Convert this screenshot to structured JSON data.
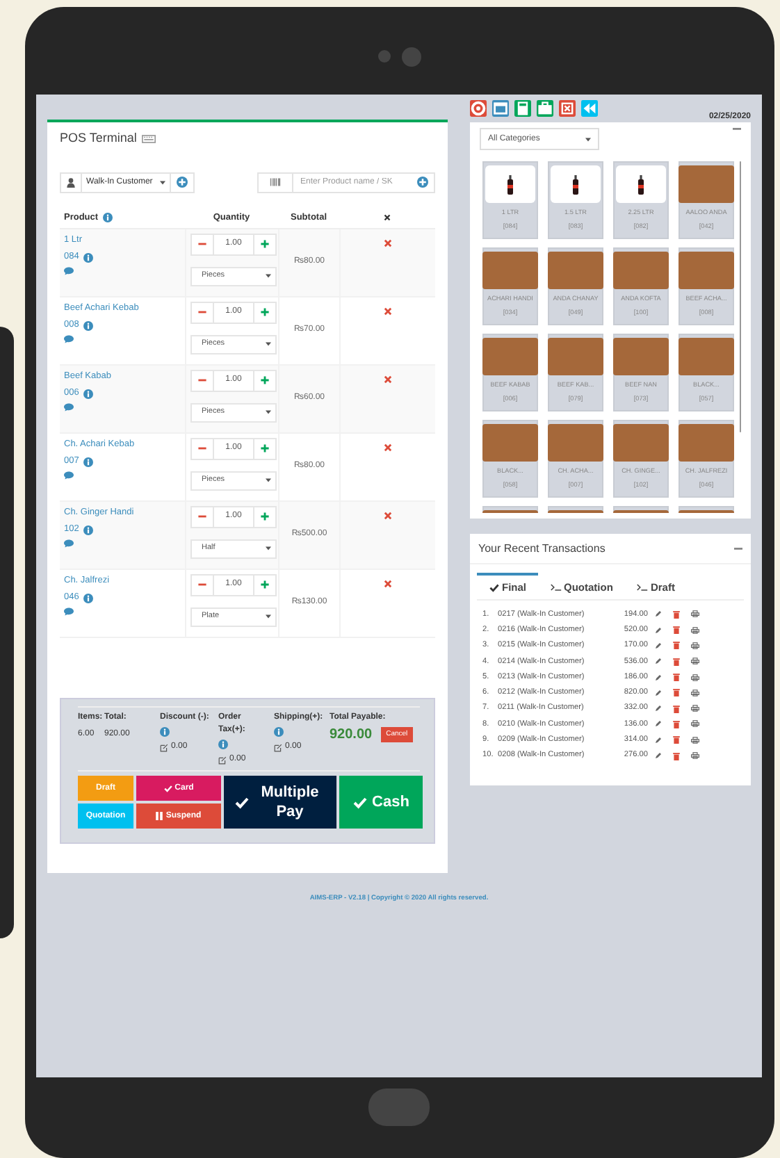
{
  "toolbar": {
    "icons": [
      {
        "kind": "lifebuoy",
        "color": "#dd4b39"
      },
      {
        "kind": "window",
        "color": "#3c8dbc"
      },
      {
        "kind": "calculator",
        "color": "#00a65a"
      },
      {
        "kind": "briefcase",
        "color": "#00a65a"
      },
      {
        "kind": "close",
        "color": "#dd4b39"
      },
      {
        "kind": "rewind",
        "color": "#00c0ef"
      }
    ],
    "date": "02/25/2020"
  },
  "pos_panel": {
    "title": "POS Terminal",
    "customer": "Walk-In Customer",
    "product_search_placeholder": "Enter Product name / SK",
    "columns": [
      "Product",
      "Quantity",
      "Subtotal"
    ],
    "cart": [
      {
        "name": "1 Ltr",
        "code": "084",
        "quantity": "1.00",
        "unit": "Pieces",
        "subtotal": "₨80.00"
      },
      {
        "name": "Beef Achari Kebab",
        "code": "008",
        "quantity": "1.00",
        "unit": "Pieces",
        "subtotal": "₨70.00"
      },
      {
        "name": "Beef Kabab",
        "code": "006",
        "quantity": "1.00",
        "unit": "Pieces",
        "subtotal": "₨60.00"
      },
      {
        "name": "Ch. Achari Kebab",
        "code": "007",
        "quantity": "1.00",
        "unit": "Pieces",
        "subtotal": "₨80.00"
      },
      {
        "name": "Ch. Ginger Handi",
        "code": "102",
        "quantity": "1.00",
        "unit": "Half",
        "subtotal": "₨500.00"
      },
      {
        "name": "Ch. Jalfrezi",
        "code": "046",
        "quantity": "1.00",
        "unit": "Plate",
        "subtotal": "₨130.00"
      }
    ],
    "summary": [
      {
        "label": "Items:",
        "value": "6.00",
        "kind": "plain"
      },
      {
        "label": "Total:",
        "value": "920.00",
        "kind": "plain"
      },
      {
        "label": "Discount (-):",
        "value": "0.00",
        "kind": "adjustment"
      },
      {
        "label": "Order Tax(+):",
        "value": "0.00",
        "kind": "adjustment"
      },
      {
        "label": "Shipping(+):",
        "value": "0.00",
        "kind": "adjustment"
      }
    ],
    "payable": {
      "label": "Total Payable:",
      "value": "920.00",
      "cancel": "Cancel"
    },
    "buttons": [
      {
        "label": "Draft",
        "kind": "draft"
      },
      {
        "label": "Card",
        "kind": "card"
      },
      {
        "label": "Multiple Pay",
        "kind": "multiple"
      },
      {
        "label": "Cash",
        "kind": "cash"
      },
      {
        "label": "Quotation",
        "kind": "quotation"
      },
      {
        "label": "Suspend",
        "kind": "suspend"
      }
    ]
  },
  "categories": {
    "filter": "All Categories",
    "products": [
      {
        "name": "1 LTR",
        "code": "[084]",
        "kind": "bottle"
      },
      {
        "name": "1.5 LTR",
        "code": "[083]",
        "kind": "bottle"
      },
      {
        "name": "2.25 LTR",
        "code": "[082]",
        "kind": "bottle"
      },
      {
        "name": "AALOO ANDA",
        "code": "[042]",
        "kind": "photo"
      },
      {
        "name": "ACHARI HANDI",
        "code": "[034]",
        "kind": "photo"
      },
      {
        "name": "ANDA CHANAY",
        "code": "[049]",
        "kind": "photo"
      },
      {
        "name": "ANDA KOFTA",
        "code": "[100]",
        "kind": "photo"
      },
      {
        "name": "BEEF ACHA...",
        "code": "[008]",
        "kind": "photo"
      },
      {
        "name": "BEEF KABAB",
        "code": "[006]",
        "kind": "photo"
      },
      {
        "name": "BEEF KAB...",
        "code": "[079]",
        "kind": "photo"
      },
      {
        "name": "BEEF NAN",
        "code": "[073]",
        "kind": "photo"
      },
      {
        "name": "BLACK...",
        "code": "[057]",
        "kind": "photo"
      },
      {
        "name": "BLACK...",
        "code": "[058]",
        "kind": "photo"
      },
      {
        "name": "CH. ACHA...",
        "code": "[007]",
        "kind": "photo"
      },
      {
        "name": "CH. GINGE...",
        "code": "[102]",
        "kind": "photo"
      },
      {
        "name": "CH. JALFREZI",
        "code": "[046]",
        "kind": "photo"
      },
      {
        "kind": "photo"
      },
      {
        "kind": "photo"
      },
      {
        "kind": "photo"
      },
      {
        "kind": "photo"
      }
    ]
  },
  "transactions": {
    "title": "Your Recent Transactions",
    "tabs": [
      {
        "label": "Final",
        "kind": "check",
        "selected": true
      },
      {
        "label": "Quotation",
        "kind": "terminal",
        "selected": false
      },
      {
        "label": "Draft",
        "kind": "terminal",
        "selected": false
      }
    ],
    "rows": [
      {
        "number": "1.",
        "ref": "0217 (Walk-In Customer)",
        "amount": "194.00"
      },
      {
        "number": "2.",
        "ref": "0216 (Walk-In Customer)",
        "amount": "520.00"
      },
      {
        "number": "3.",
        "ref": "0215 (Walk-In Customer)",
        "amount": "170.00"
      },
      {
        "number": "4.",
        "ref": "0214 (Walk-In Customer)",
        "amount": "536.00"
      },
      {
        "number": "5.",
        "ref": "0213 (Walk-In Customer)",
        "amount": "186.00"
      },
      {
        "number": "6.",
        "ref": "0212 (Walk-In Customer)",
        "amount": "820.00"
      },
      {
        "number": "7.",
        "ref": "0211 (Walk-In Customer)",
        "amount": "332.00"
      },
      {
        "number": "8.",
        "ref": "0210 (Walk-In Customer)",
        "amount": "136.00"
      },
      {
        "number": "9.",
        "ref": "0209 (Walk-In Customer)",
        "amount": "314.00"
      },
      {
        "number": "10.",
        "ref": "0208 (Walk-In Customer)",
        "amount": "276.00"
      }
    ]
  },
  "footer": "AIMS-ERP - V2.18 | Copyright © 2020 All rights reserved."
}
